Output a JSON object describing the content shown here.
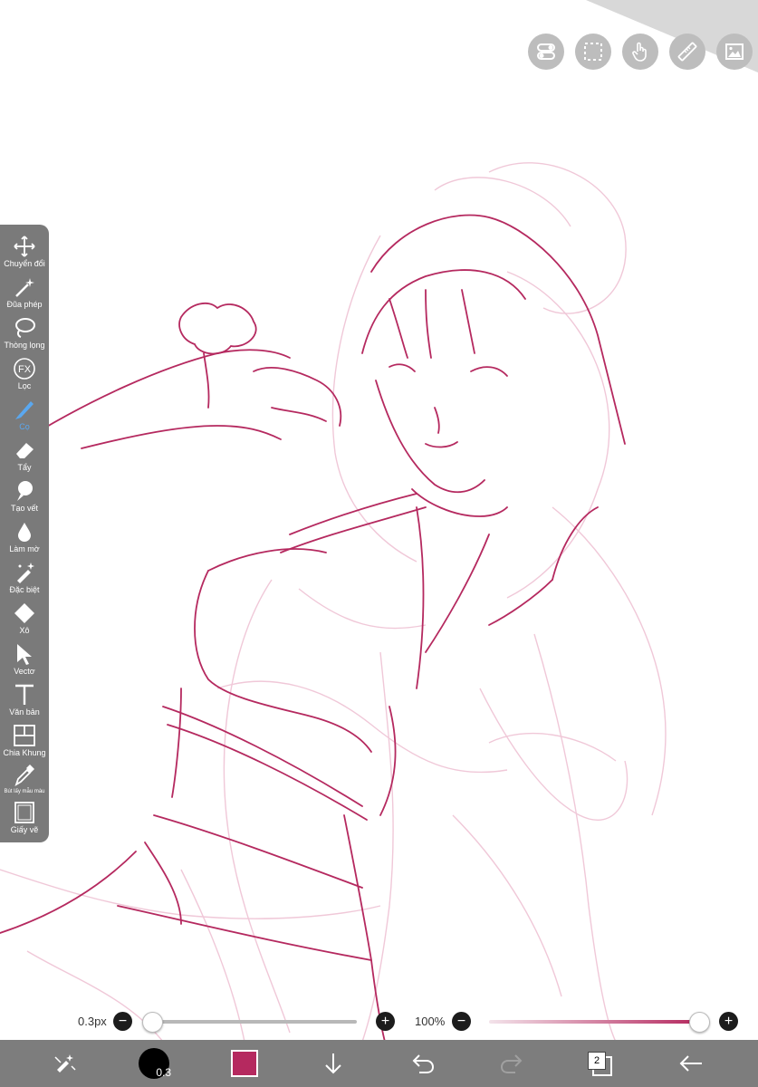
{
  "toolbar": {
    "items": [
      {
        "label": "Chuyển đổi",
        "icon": "move-icon"
      },
      {
        "label": "Đũa phép",
        "icon": "magic-wand-icon"
      },
      {
        "label": "Thòng lọng",
        "icon": "lasso-icon"
      },
      {
        "label": "Lọc",
        "icon": "fx-icon"
      },
      {
        "label": "Cọ",
        "icon": "brush-icon",
        "active": true
      },
      {
        "label": "Tẩy",
        "icon": "eraser-icon"
      },
      {
        "label": "Tạo vết",
        "icon": "smudge-icon"
      },
      {
        "label": "Làm mờ",
        "icon": "blur-icon"
      },
      {
        "label": "Đặc biệt",
        "icon": "special-brush-icon"
      },
      {
        "label": "Xô",
        "icon": "bucket-icon"
      },
      {
        "label": "Vectơ",
        "icon": "vector-icon"
      },
      {
        "label": "Văn bản",
        "icon": "text-icon"
      },
      {
        "label": "Chia Khung",
        "icon": "frame-divider-icon"
      },
      {
        "label": "Bút lấy mẫu màu",
        "icon": "eyedropper-icon"
      },
      {
        "label": "Giấy vẽ",
        "icon": "canvas-icon"
      }
    ]
  },
  "top_buttons": [
    "toggle-icon",
    "selection-icon",
    "hand-icon",
    "ruler-icon",
    "image-icon"
  ],
  "brush": {
    "size_label": "0.3px",
    "size_fraction": 0.0,
    "opacity_label": "100%",
    "opacity_fraction": 1.0,
    "size_badge": "0.3"
  },
  "bottom": {
    "color": "#b5295f",
    "layer_count": "2"
  },
  "colors": {
    "line_main": "#b5295f",
    "line_sketch": "#f0c8d8",
    "toolbar_bg": "#7a7a7a",
    "active": "#5aa8f0"
  }
}
